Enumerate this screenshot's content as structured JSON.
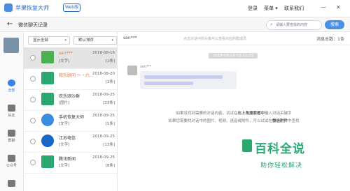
{
  "app": {
    "name": "苹果恢复大师",
    "badge": "Web版"
  },
  "topmenu": {
    "login": "登录",
    "menu": "菜单",
    "contact": "联系我们"
  },
  "window": {
    "minimize": "—",
    "close": "✕"
  },
  "subbar": {
    "back": "←",
    "title": "微信聊天记录"
  },
  "search": {
    "placeholder": "请输入要查找的内容",
    "button": "搜索"
  },
  "leftnav": [
    {
      "label": "全部",
      "icon": "clock-icon",
      "active": true
    },
    {
      "label": "好友",
      "icon": "person-icon",
      "active": false
    },
    {
      "label": "群聊",
      "icon": "group-icon",
      "active": false
    },
    {
      "label": "公众号",
      "icon": "grid-icon",
      "active": false
    },
    {
      "label": "",
      "icon": "person-icon",
      "active": false
    }
  ],
  "filters": {
    "show": "显示全部",
    "sort": "默认排序"
  },
  "conversations": [
    {
      "name": "sen***",
      "date": "2018-08-16",
      "preview": "[文字]",
      "count": "[1条]",
      "orange": true,
      "avatar_color": "#4caf50"
    },
    {
      "name": "释乐顾问 ～・六...",
      "date": "2018-08-20",
      "preview": "",
      "count": "[1条]",
      "orange": true,
      "avatar_color": "#2aa86f"
    },
    {
      "name": "欢乐颂沙群",
      "date": "2018-09-25",
      "preview": "[图片]",
      "count": "[23条]",
      "orange": false,
      "avatar_color": "#2aa86f"
    },
    {
      "name": "手机恢复大师",
      "date": "2018-09-25",
      "preview": "[文字]",
      "count": "[1条]",
      "orange": false,
      "avatar_color": "#3b8de0"
    },
    {
      "name": "江苏电信",
      "date": "2018-09-25",
      "preview": "[文字]",
      "count": "[13条]",
      "orange": false,
      "avatar_color": "#1a66c8"
    },
    {
      "name": "腾讯新闻",
      "date": "2018-09-25",
      "preview": "[文字]",
      "count": "[8条]",
      "orange": false,
      "avatar_color": "#2aa86f"
    }
  ],
  "chat": {
    "name": "sen***",
    "note": "点击对话中的头像可以查看对应的群成员",
    "count": "消息总数：1条",
    "timestamp": "2018-08-16 15:11:25",
    "msg_sender": "sen***",
    "help1_pre": "如果没找到需要的对话内容，试试在",
    "help1_bold": "右上角搜索框中",
    "help1_post": "输入对话关键字",
    "help2_pre": "如果您需要找对话中的图片、视频、语音或附件，可以试试在",
    "help2_bold": "微信附件",
    "help2_post": "中查找"
  },
  "watermark": {
    "big": "百科全说",
    "small": "助你轻松解决"
  }
}
